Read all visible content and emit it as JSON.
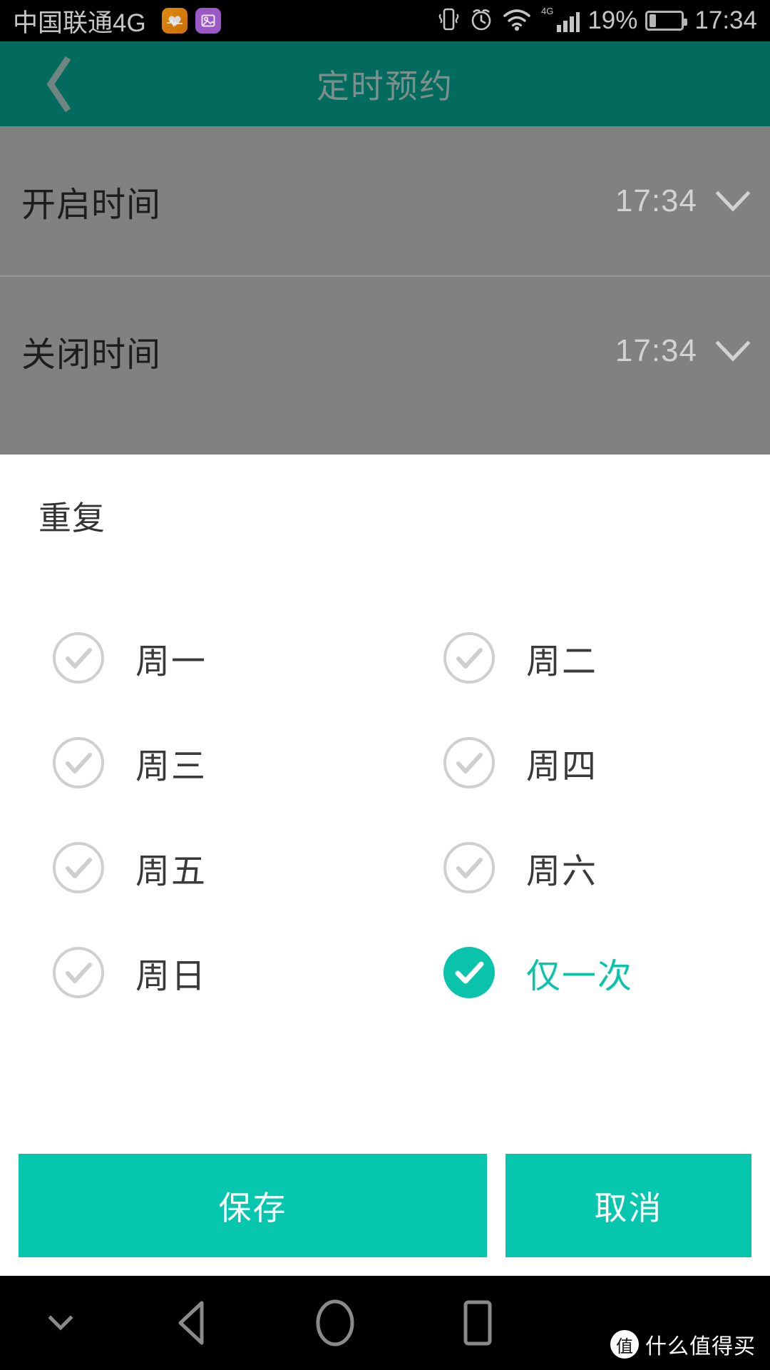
{
  "statusbar": {
    "carrier": "中国联通4G",
    "app_icons": [
      {
        "name": "health-app-icon",
        "color": "#d4800c"
      },
      {
        "name": "gallery-app-icon",
        "color": "#9b59c6"
      }
    ],
    "icons": [
      "vibrate-icon",
      "alarm-icon",
      "wifi-icon",
      "4g-signal-icon"
    ],
    "network_label": "4G",
    "battery_percent": "19%",
    "battery_level": 19,
    "time": "17:34"
  },
  "appbar": {
    "title": "定时预约",
    "back_icon": "chevron-left-icon",
    "bg_color": "#026b5d",
    "title_color": "#7d8f8c"
  },
  "time_panel": {
    "rows": [
      {
        "label": "开启时间",
        "value": "17:34",
        "chevron": "chevron-down-icon"
      },
      {
        "label": "关闭时间",
        "value": "17:34",
        "chevron": "chevron-down-icon"
      }
    ]
  },
  "repeat": {
    "title": "重复",
    "accent_color": "#09c4ab",
    "options": [
      {
        "label": "周一",
        "checked": false
      },
      {
        "label": "周二",
        "checked": false
      },
      {
        "label": "周三",
        "checked": false
      },
      {
        "label": "周四",
        "checked": false
      },
      {
        "label": "周五",
        "checked": false
      },
      {
        "label": "周六",
        "checked": false
      },
      {
        "label": "周日",
        "checked": false
      },
      {
        "label": "仅一次",
        "checked": true
      }
    ]
  },
  "actions": {
    "save_label": "保存",
    "cancel_label": "取消",
    "button_color": "#06c7ad"
  },
  "navbar": {
    "hide_icon": "chevron-down-icon",
    "back_icon": "triangle-back-icon",
    "home_icon": "circle-home-icon",
    "recent_icon": "square-recents-icon"
  },
  "watermark": {
    "badge": "值",
    "text": "什么值得买"
  }
}
